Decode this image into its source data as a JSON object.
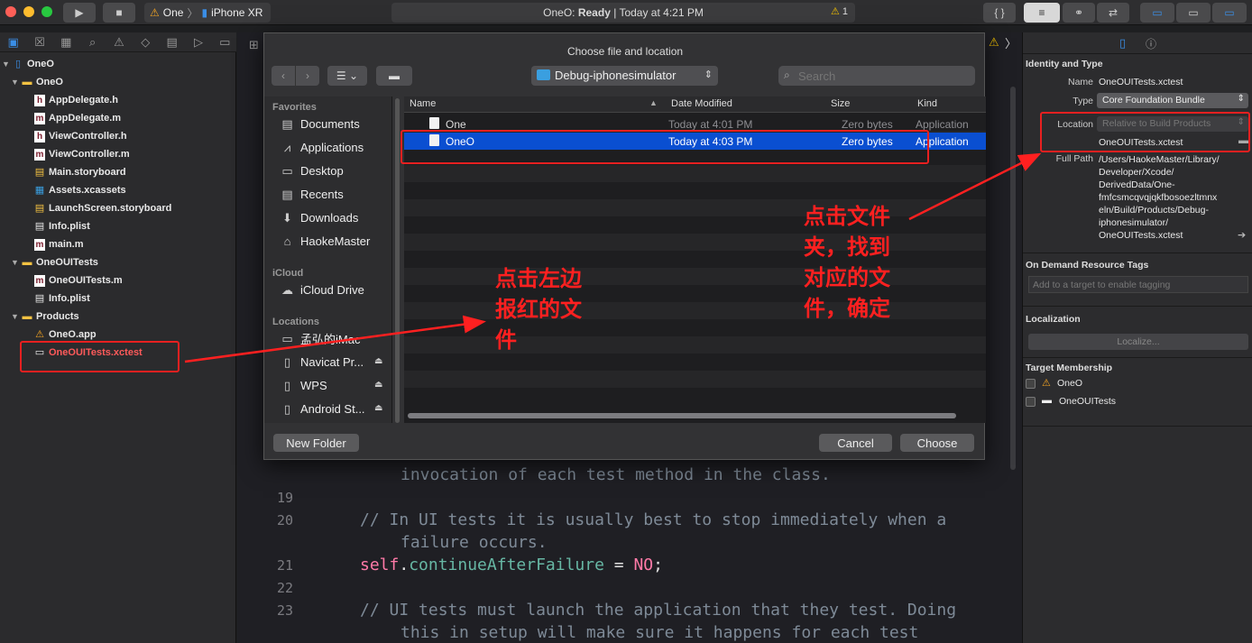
{
  "toolbar": {
    "scheme": "One",
    "device": "iPhone XR",
    "status_app": "OneO:",
    "status_state": "Ready",
    "status_time": "| Today at 4:21 PM",
    "warning_count": "1"
  },
  "navigator": {
    "items": [
      {
        "label": "OneO",
        "icon": "project-icon",
        "level": 0,
        "disclosure": "open"
      },
      {
        "label": "OneO",
        "icon": "folder-icon",
        "level": 1,
        "disclosure": "open"
      },
      {
        "label": "AppDelegate.h",
        "icon": "header-file-icon",
        "level": 2
      },
      {
        "label": "AppDelegate.m",
        "icon": "source-file-icon",
        "level": 2
      },
      {
        "label": "ViewController.h",
        "icon": "header-file-icon",
        "level": 2
      },
      {
        "label": "ViewController.m",
        "icon": "source-file-icon",
        "level": 2
      },
      {
        "label": "Main.storyboard",
        "icon": "storyboard-icon",
        "level": 2
      },
      {
        "label": "Assets.xcassets",
        "icon": "assets-icon",
        "level": 2
      },
      {
        "label": "LaunchScreen.storyboard",
        "icon": "storyboard-icon",
        "level": 2
      },
      {
        "label": "Info.plist",
        "icon": "plist-icon",
        "level": 2
      },
      {
        "label": "main.m",
        "icon": "source-file-icon",
        "level": 2
      },
      {
        "label": "OneOUITests",
        "icon": "folder-icon",
        "level": 1,
        "disclosure": "open"
      },
      {
        "label": "OneOUITests.m",
        "icon": "source-file-icon",
        "level": 2
      },
      {
        "label": "Info.plist",
        "icon": "plist-icon",
        "level": 2
      },
      {
        "label": "Products",
        "icon": "folder-icon",
        "level": 1,
        "disclosure": "open"
      },
      {
        "label": "OneO.app",
        "icon": "app-icon",
        "level": 2
      },
      {
        "label": "OneOUITests.xctest",
        "icon": "xctest-bundle-icon",
        "level": 2,
        "missing": true
      }
    ]
  },
  "editor": {
    "lines": [
      {
        "num": "",
        "parts": [
          {
            "t": "invocation of each test method in the class.",
            "c": "cmt"
          }
        ],
        "indent": 2
      },
      {
        "num": "19",
        "parts": [],
        "indent": 0
      },
      {
        "num": "20",
        "parts": [
          {
            "t": "// In UI tests it is usually best to stop immediately when a",
            "c": "cmt"
          }
        ],
        "indent": 1
      },
      {
        "num": "",
        "parts": [
          {
            "t": "failure occurs.",
            "c": "cmt"
          }
        ],
        "indent": 2
      },
      {
        "num": "21",
        "parts": [
          {
            "t": "self",
            "c": "kw"
          },
          {
            "t": ".",
            "c": ""
          },
          {
            "t": "continueAfterFailure",
            "c": "fn"
          },
          {
            "t": " = ",
            "c": ""
          },
          {
            "t": "NO",
            "c": "kw"
          },
          {
            "t": ";",
            "c": ""
          }
        ],
        "indent": 1
      },
      {
        "num": "22",
        "parts": [],
        "indent": 0
      },
      {
        "num": "23",
        "parts": [
          {
            "t": "// UI tests must launch the application that they test. Doing",
            "c": "cmt"
          }
        ],
        "indent": 1
      },
      {
        "num": "",
        "parts": [
          {
            "t": "this in setup will make sure it happens for each test",
            "c": "cmt"
          }
        ],
        "indent": 2
      }
    ]
  },
  "dialog": {
    "title": "Choose file and location",
    "location_popup": "Debug-iphonesimulator",
    "search_placeholder": "Search",
    "sidebar": {
      "favorites_header": "Favorites",
      "favorites": [
        {
          "label": "Documents",
          "icon": "documents-icon"
        },
        {
          "label": "Applications",
          "icon": "applications-icon"
        },
        {
          "label": "Desktop",
          "icon": "desktop-icon"
        },
        {
          "label": "Recents",
          "icon": "recents-icon"
        },
        {
          "label": "Downloads",
          "icon": "downloads-icon"
        },
        {
          "label": "HaokeMaster",
          "icon": "home-icon"
        }
      ],
      "icloud_header": "iCloud",
      "icloud": [
        {
          "label": "iCloud Drive",
          "icon": "icloud-icon"
        }
      ],
      "locations_header": "Locations",
      "locations": [
        {
          "label": "孟弘的iMac",
          "icon": "imac-icon"
        },
        {
          "label": "Navicat Pr...",
          "icon": "disk-icon",
          "eject": true
        },
        {
          "label": "WPS",
          "icon": "disk-icon",
          "eject": true
        },
        {
          "label": "Android St...",
          "icon": "disk-icon",
          "eject": true
        }
      ]
    },
    "columns": {
      "name": "Name",
      "date": "Date Modified",
      "size": "Size",
      "kind": "Kind"
    },
    "files": [
      {
        "name": "One",
        "date": "Today at 4:01 PM",
        "size": "Zero bytes",
        "kind": "Application",
        "selected": false
      },
      {
        "name": "OneO",
        "date": "Today at 4:03 PM",
        "size": "Zero bytes",
        "kind": "Application",
        "selected": true
      }
    ],
    "new_folder_label": "New Folder",
    "cancel_label": "Cancel",
    "choose_label": "Choose"
  },
  "inspector": {
    "identity_header": "Identity and Type",
    "name_label": "Name",
    "name_value": "OneOUITests.xctest",
    "type_label": "Type",
    "type_value": "Core Foundation Bundle",
    "location_label": "Location",
    "location_value": "Relative to Build Products",
    "location_file": "OneOUITests.xctest",
    "fullpath_label": "Full Path",
    "fullpath_lines": [
      "/Users/HaokeMaster/Library/",
      "Developer/Xcode/",
      "DerivedData/One-",
      "fmfcsmcqvqjqkfbosoezltmnx",
      "eln/Build/Products/Debug-",
      "iphonesimulator/",
      "OneOUITests.xctest"
    ],
    "odr_header": "On Demand Resource Tags",
    "odr_placeholder": "Add to a target to enable tagging",
    "localization_header": "Localization",
    "localize_button": "Localize...",
    "target_header": "Target Membership",
    "targets": [
      {
        "label": "OneO",
        "icon": "app-target-icon"
      },
      {
        "label": "OneOUITests",
        "icon": "test-target-icon"
      }
    ]
  },
  "annotations": {
    "left_note": [
      "点击左边",
      "报红的文",
      "件"
    ],
    "right_note": [
      "点击文件",
      "夹，找到",
      "对应的文",
      "件，确定"
    ],
    "annotation_color": "#ff2020"
  }
}
